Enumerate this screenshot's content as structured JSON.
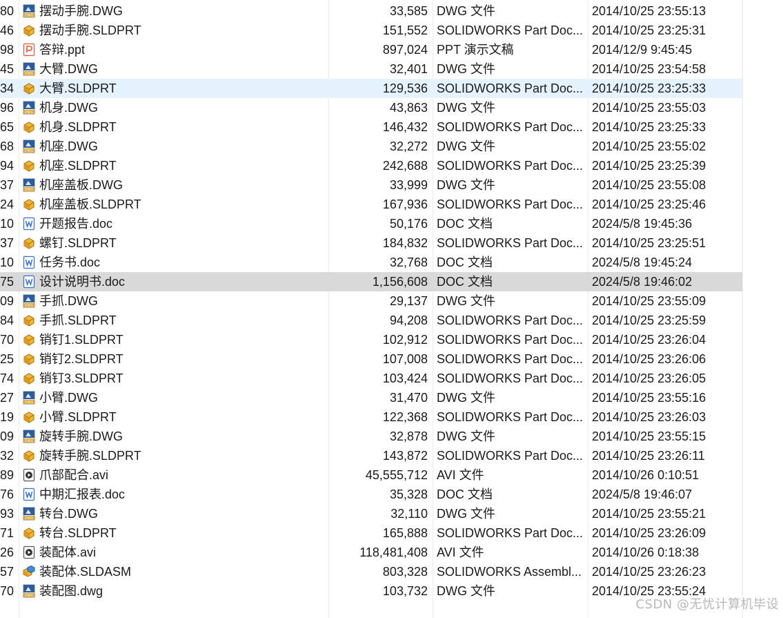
{
  "files": [
    {
      "id": "80",
      "icon": "dwg-file-icon",
      "name": "摆动手腕.DWG",
      "size": "33,585",
      "type": "DWG 文件",
      "date": "2014/10/25 23:55:13"
    },
    {
      "id": "46",
      "icon": "sldprt-file-icon",
      "name": "摆动手腕.SLDPRT",
      "size": "151,552",
      "type": "SOLIDWORKS Part Doc...",
      "date": "2014/10/25 23:25:31"
    },
    {
      "id": "98",
      "icon": "ppt-file-icon",
      "name": "答辩.ppt",
      "size": "897,024",
      "type": "PPT 演示文稿",
      "date": "2014/12/9 9:45:45"
    },
    {
      "id": "45",
      "icon": "dwg-file-icon",
      "name": "大臂.DWG",
      "size": "32,401",
      "type": "DWG 文件",
      "date": "2014/10/25 23:54:58"
    },
    {
      "id": "34",
      "icon": "sldprt-file-icon",
      "name": "大臂.SLDPRT",
      "size": "129,536",
      "type": "SOLIDWORKS Part Doc...",
      "date": "2014/10/25 23:25:33"
    },
    {
      "id": "96",
      "icon": "dwg-file-icon",
      "name": "机身.DWG",
      "size": "43,863",
      "type": "DWG 文件",
      "date": "2014/10/25 23:55:03"
    },
    {
      "id": "65",
      "icon": "sldprt-file-icon",
      "name": "机身.SLDPRT",
      "size": "146,432",
      "type": "SOLIDWORKS Part Doc...",
      "date": "2014/10/25 23:25:33"
    },
    {
      "id": "68",
      "icon": "dwg-file-icon",
      "name": "机座.DWG",
      "size": "32,272",
      "type": "DWG 文件",
      "date": "2014/10/25 23:55:02"
    },
    {
      "id": "94",
      "icon": "sldprt-file-icon",
      "name": "机座.SLDPRT",
      "size": "242,688",
      "type": "SOLIDWORKS Part Doc...",
      "date": "2014/10/25 23:25:39"
    },
    {
      "id": "37",
      "icon": "dwg-file-icon",
      "name": "机座盖板.DWG",
      "size": "33,999",
      "type": "DWG 文件",
      "date": "2014/10/25 23:55:08"
    },
    {
      "id": "24",
      "icon": "sldprt-file-icon",
      "name": "机座盖板.SLDPRT",
      "size": "167,936",
      "type": "SOLIDWORKS Part Doc...",
      "date": "2014/10/25 23:25:46"
    },
    {
      "id": "10",
      "icon": "doc-file-icon",
      "name": "开题报告.doc",
      "size": "50,176",
      "type": "DOC 文档",
      "date": "2024/5/8 19:45:36"
    },
    {
      "id": "37",
      "icon": "sldprt-file-icon",
      "name": "螺钉.SLDPRT",
      "size": "184,832",
      "type": "SOLIDWORKS Part Doc...",
      "date": "2014/10/25 23:25:51"
    },
    {
      "id": "10",
      "icon": "doc-file-icon",
      "name": "任务书.doc",
      "size": "32,768",
      "type": "DOC 文档",
      "date": "2024/5/8 19:45:24"
    },
    {
      "id": "75",
      "icon": "doc-file-icon",
      "name": "设计说明书.doc",
      "size": "1,156,608",
      "type": "DOC 文档",
      "date": "2024/5/8 19:46:02"
    },
    {
      "id": "09",
      "icon": "dwg-file-icon",
      "name": "手抓.DWG",
      "size": "29,137",
      "type": "DWG 文件",
      "date": "2014/10/25 23:55:09"
    },
    {
      "id": "84",
      "icon": "sldprt-file-icon",
      "name": "手抓.SLDPRT",
      "size": "94,208",
      "type": "SOLIDWORKS Part Doc...",
      "date": "2014/10/25 23:25:59"
    },
    {
      "id": "70",
      "icon": "sldprt-file-icon",
      "name": "销钉1.SLDPRT",
      "size": "102,912",
      "type": "SOLIDWORKS Part Doc...",
      "date": "2014/10/25 23:26:04"
    },
    {
      "id": "25",
      "icon": "sldprt-file-icon",
      "name": "销钉2.SLDPRT",
      "size": "107,008",
      "type": "SOLIDWORKS Part Doc...",
      "date": "2014/10/25 23:26:06"
    },
    {
      "id": "74",
      "icon": "sldprt-file-icon",
      "name": "销钉3.SLDPRT",
      "size": "103,424",
      "type": "SOLIDWORKS Part Doc...",
      "date": "2014/10/25 23:26:05"
    },
    {
      "id": "27",
      "icon": "dwg-file-icon",
      "name": "小臂.DWG",
      "size": "31,470",
      "type": "DWG 文件",
      "date": "2014/10/25 23:55:16"
    },
    {
      "id": "19",
      "icon": "sldprt-file-icon",
      "name": "小臂.SLDPRT",
      "size": "122,368",
      "type": "SOLIDWORKS Part Doc...",
      "date": "2014/10/25 23:26:03"
    },
    {
      "id": "09",
      "icon": "dwg-file-icon",
      "name": "旋转手腕.DWG",
      "size": "32,878",
      "type": "DWG 文件",
      "date": "2014/10/25 23:55:15"
    },
    {
      "id": "32",
      "icon": "sldprt-file-icon",
      "name": "旋转手腕.SLDPRT",
      "size": "143,872",
      "type": "SOLIDWORKS Part Doc...",
      "date": "2014/10/25 23:26:11"
    },
    {
      "id": "89",
      "icon": "avi-file-icon",
      "name": "爪部配合.avi",
      "size": "45,555,712",
      "type": "AVI 文件",
      "date": "2014/10/26 0:10:51"
    },
    {
      "id": "76",
      "icon": "doc-file-icon",
      "name": "中期汇报表.doc",
      "size": "35,328",
      "type": "DOC 文档",
      "date": "2024/5/8 19:46:07"
    },
    {
      "id": "93",
      "icon": "dwg-file-icon",
      "name": "转台.DWG",
      "size": "32,110",
      "type": "DWG 文件",
      "date": "2014/10/25 23:55:21"
    },
    {
      "id": "71",
      "icon": "sldprt-file-icon",
      "name": "转台.SLDPRT",
      "size": "165,888",
      "type": "SOLIDWORKS Part Doc...",
      "date": "2014/10/25 23:26:09"
    },
    {
      "id": "26",
      "icon": "avi-file-icon",
      "name": "装配体.avi",
      "size": "118,481,408",
      "type": "AVI 文件",
      "date": "2014/10/26 0:18:38"
    },
    {
      "id": "57",
      "icon": "sldasm-file-icon",
      "name": "装配体.SLDASM",
      "size": "803,328",
      "type": "SOLIDWORKS Assembl...",
      "date": "2014/10/25 23:26:23"
    },
    {
      "id": "70",
      "icon": "dwg-file-icon",
      "name": "装配图.dwg",
      "size": "103,732",
      "type": "DWG 文件",
      "date": "2014/10/25 23:55:24"
    }
  ],
  "hover_row": 4,
  "selected_row": 14,
  "watermark": "CSDN @无忧计算机毕设",
  "colors": {
    "hover_bg": "#e5f3ff",
    "selected_bg": "#d9d9d9",
    "text": "#1a1a1a"
  }
}
